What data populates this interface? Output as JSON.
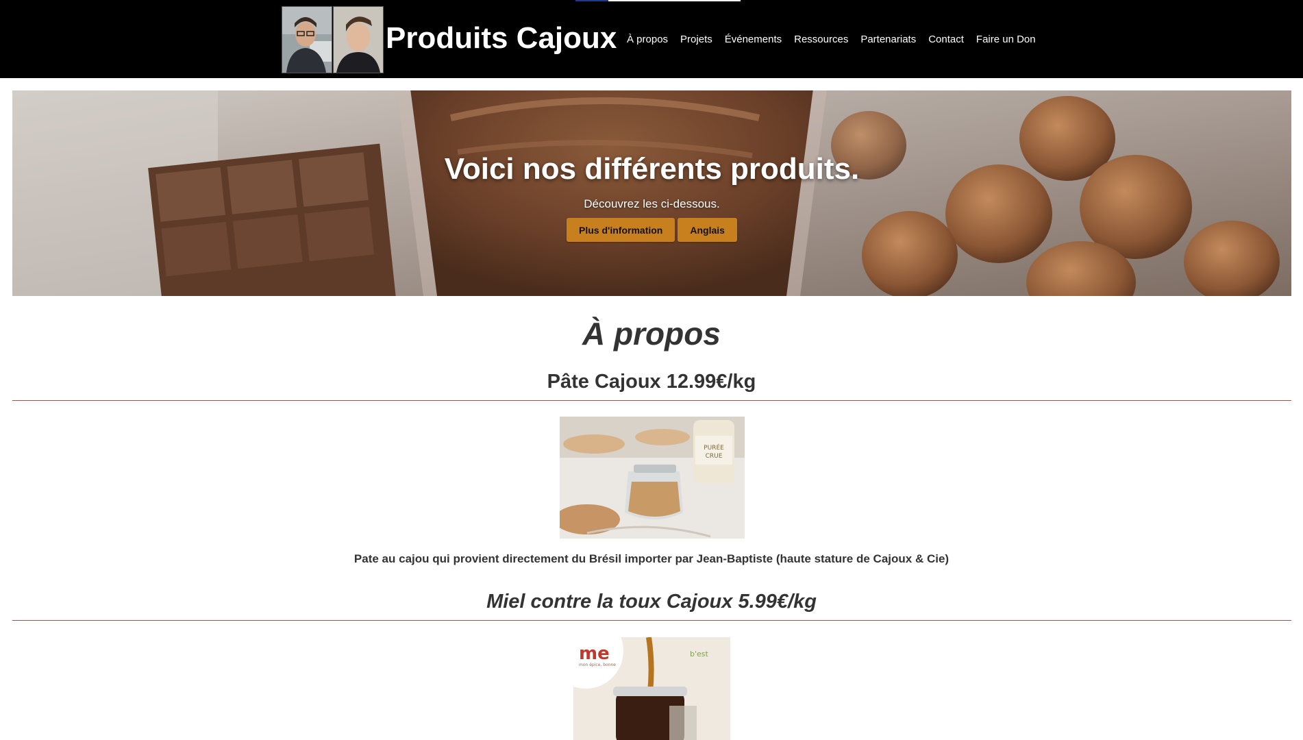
{
  "header": {
    "brand": "Produits Cajoux",
    "progress": 0.2,
    "nav": [
      "À propos",
      "Projets",
      "Événements",
      "Ressources",
      "Partenariats",
      "Contact",
      "Faire un Don"
    ]
  },
  "hero": {
    "title": "Voici nos différents produits.",
    "subtitle": "Découvrez les ci-dessous.",
    "buttons": [
      "Plus d'information",
      "Anglais"
    ]
  },
  "about": {
    "title": "À propos"
  },
  "products": [
    {
      "title": "Pâte Cajoux 12.99€/kg",
      "description": "Pate au cajou qui provient directement du Brésil importer par Jean-Baptiste (haute stature de Cajoux & Cie)",
      "jar_label": [
        "PURÉE",
        "CRUE"
      ]
    },
    {
      "title": "Miel contre la toux Cajoux 5.99€/kg",
      "logo_text": "me",
      "logo_tagline": "mon épice, bonne",
      "badge_text": "b'est"
    }
  ],
  "colors": {
    "accent": "#c8801f",
    "divider": "#a05050",
    "header_bg": "#000000"
  }
}
